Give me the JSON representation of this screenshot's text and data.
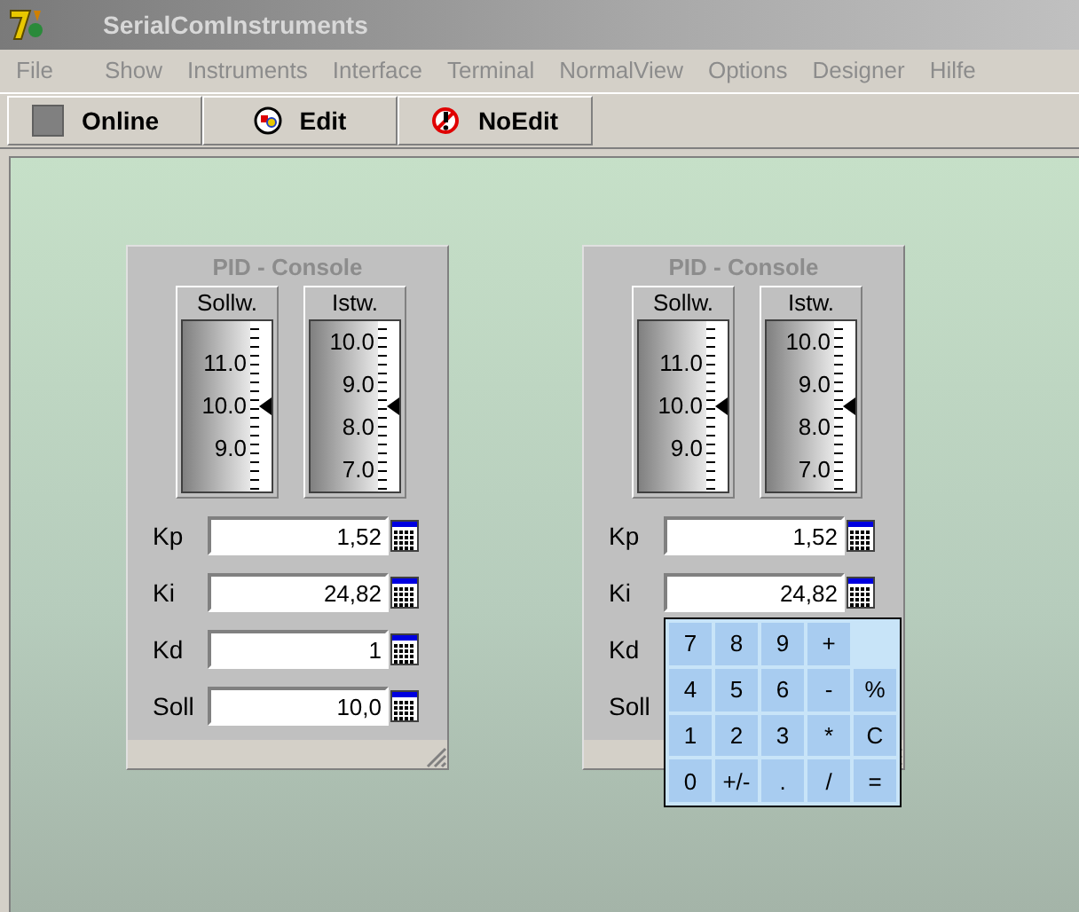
{
  "window": {
    "title": "SerialComInstruments"
  },
  "menu": [
    {
      "label": "File",
      "disabled": true
    },
    {
      "label": "Show",
      "disabled": true
    },
    {
      "label": "Instruments",
      "disabled": true
    },
    {
      "label": "Interface",
      "disabled": true
    },
    {
      "label": "Terminal",
      "disabled": true
    },
    {
      "label": "NormalView",
      "disabled": true
    },
    {
      "label": "Options",
      "disabled": true
    },
    {
      "label": "Designer",
      "disabled": true
    },
    {
      "label": "Hilfe",
      "disabled": true
    }
  ],
  "toolbar": [
    {
      "label": "Online",
      "kind": "online"
    },
    {
      "label": "Edit",
      "kind": "edit"
    },
    {
      "label": "NoEdit",
      "kind": "noedit"
    }
  ],
  "consoles": [
    {
      "title": "PID - Console",
      "gauges": [
        {
          "label": "Sollw.",
          "ticks": [
            "11.0",
            "10.0",
            "9.0"
          ],
          "level": 0.5
        },
        {
          "label": "Istw.",
          "ticks": [
            "10.0",
            "9.0",
            "8.0",
            "7.0"
          ],
          "level": 0.5
        }
      ],
      "fields": [
        {
          "label": "Kp",
          "value": "1,52"
        },
        {
          "label": "Ki",
          "value": "24,82"
        },
        {
          "label": "Kd",
          "value": "1"
        },
        {
          "label": "Soll",
          "value": "10,0"
        }
      ]
    },
    {
      "title": "PID - Console",
      "gauges": [
        {
          "label": "Sollw.",
          "ticks": [
            "11.0",
            "10.0",
            "9.0"
          ],
          "level": 0.5
        },
        {
          "label": "Istw.",
          "ticks": [
            "10.0",
            "9.0",
            "8.0",
            "7.0"
          ],
          "level": 0.5
        }
      ],
      "fields": [
        {
          "label": "Kp",
          "value": "1,52"
        },
        {
          "label": "Ki",
          "value": "24,82"
        },
        {
          "label": "Kd"
        },
        {
          "label": "Soll"
        }
      ],
      "keypad": [
        [
          "7",
          "8",
          "9",
          "+"
        ],
        [
          "4",
          "5",
          "6",
          "-",
          "%"
        ],
        [
          "1",
          "2",
          "3",
          "*",
          "C"
        ],
        [
          "0",
          "+/-",
          ".",
          "/",
          "="
        ]
      ]
    }
  ]
}
